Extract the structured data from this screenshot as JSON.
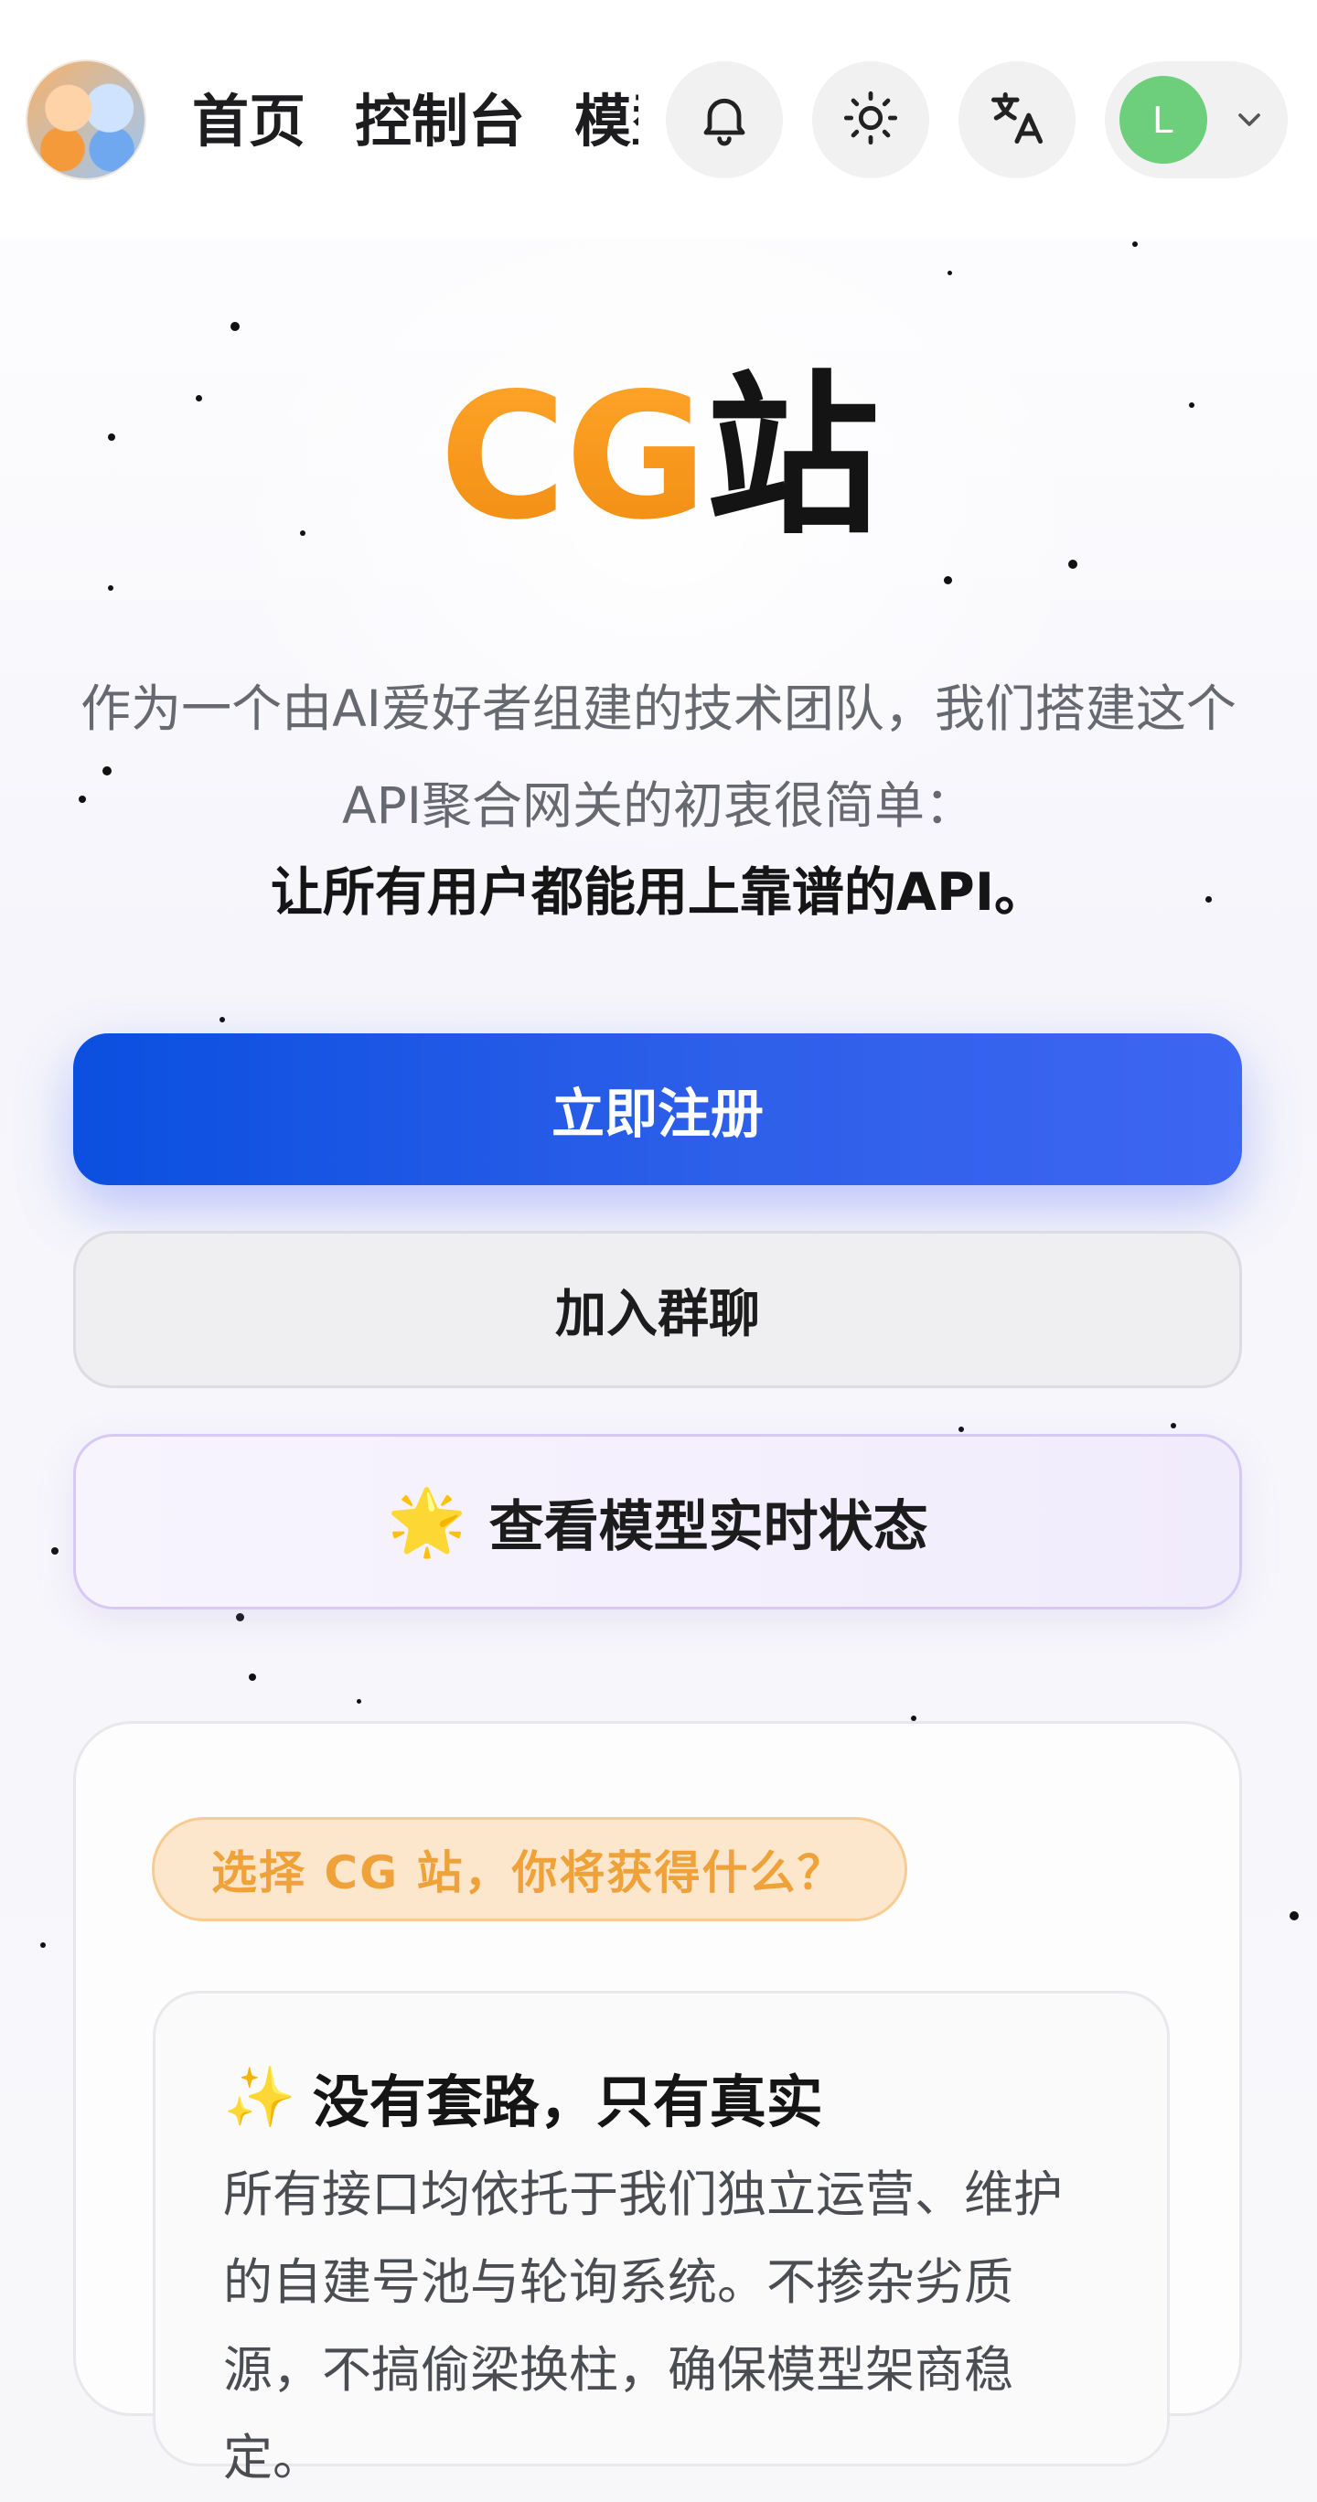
{
  "header": {
    "nav": [
      "首页",
      "控制台",
      "模型广场"
    ],
    "icons": [
      "bell-icon",
      "sun-icon",
      "translate-icon"
    ],
    "user_initial": "L"
  },
  "hero": {
    "title_cg": "CG",
    "title_zhan": "站",
    "description": "作为一个由AI爱好者组建的技术团队，我们搭建这个API聚合网关的初衷很简单：",
    "tagline": "让所有用户都能用上靠谱的API。"
  },
  "buttons": {
    "register": "立即注册",
    "join_group": "加入群聊",
    "status_emoji": "🌟",
    "status": "查看模型实时状态"
  },
  "card": {
    "pill": "选择 CG 站，你将获得什么？",
    "feature": {
      "emoji": "✨",
      "title": "没有套路，只有真实",
      "text": "所有接口均依托于我们独立运营、维护的自建号池与轮询系统。不掺杂劣质源，不搞偷梁换柱，确保模型架商稳定。"
    }
  },
  "colors": {
    "accent_orange": "#f39c1f",
    "primary_blue": "#2d5fe9",
    "avatar_green": "#6dcf7c",
    "status_border": "#d6c9f4"
  }
}
